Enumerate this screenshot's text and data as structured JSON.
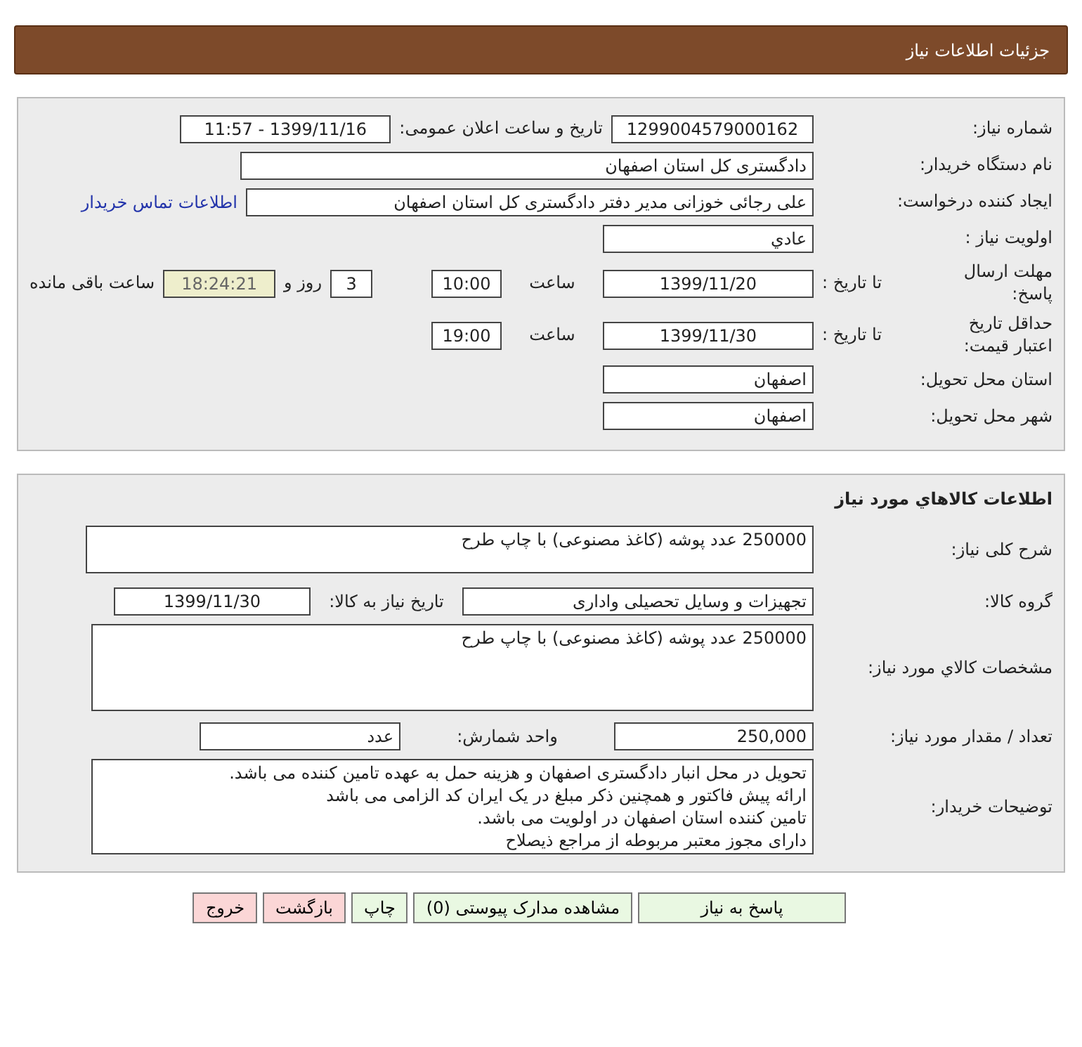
{
  "header": {
    "title": "جزئیات اطلاعات نیاز"
  },
  "general": {
    "need_number": {
      "label": "شماره نیاز:",
      "value": "1299004579000162"
    },
    "announce": {
      "label": "تاریخ و ساعت اعلان عمومی:",
      "value": "1399/11/16 - 11:57"
    },
    "buyer_org": {
      "label": "نام دستگاه خریدار:",
      "value": "دادگستری کل استان اصفهان"
    },
    "creator": {
      "label": "ایجاد کننده درخواست:",
      "value": "علی رجائی خوزانی مدیر دفتر دادگستری کل استان اصفهان",
      "link": "اطلاعات تماس خریدار"
    },
    "priority": {
      "label": "اولویت نیاز :",
      "value": "عادي"
    },
    "response_deadline": {
      "label": "مهلت ارسال پاسخ:",
      "sublabel": "تا تاریخ :",
      "date": "1399/11/20",
      "time_label": "ساعت",
      "time": "10:00",
      "days": "3",
      "days_label": "روز و",
      "remaining": "18:24:21",
      "remaining_label": "ساعت باقی مانده"
    },
    "price_validity": {
      "label": "حداقل تاریخ اعتبار قیمت:",
      "sublabel": "تا تاریخ :",
      "date": "1399/11/30",
      "time_label": "ساعت",
      "time": "19:00"
    },
    "province": {
      "label": "استان محل تحویل:",
      "value": "اصفهان"
    },
    "city": {
      "label": "شهر محل تحویل:",
      "value": "اصفهان"
    }
  },
  "goods": {
    "title": "اطلاعات کالاهاي مورد نیاز",
    "summary": {
      "label": "شرح کلی نیاز:",
      "value": "250000 عدد پوشه (کاغذ مصنوعی) با چاپ طرح"
    },
    "group": {
      "label": "گروه کالا:",
      "value": "تجهیزات و وسایل تحصیلی واداری"
    },
    "need_date": {
      "label": "تاریخ نیاز به کالا:",
      "value": "1399/11/30"
    },
    "specs": {
      "label": "مشخصات کالاي مورد نیاز:",
      "value": "250000 عدد پوشه (کاغذ مصنوعی) با چاپ طرح"
    },
    "quantity": {
      "label": "تعداد / مقدار مورد نیاز:",
      "value": "250,000"
    },
    "unit": {
      "label": "واحد شمارش:",
      "value": "عدد"
    },
    "notes": {
      "label": "توضیحات خریدار:",
      "lines": [
        "تحویل در محل انبار دادگستری اصفهان و هزینه حمل به عهده تامین کننده می باشد.",
        "ارائه پیش فاکتور و همچنین ذکر مبلغ در یک ایران کد الزامی می باشد",
        "تامین کننده استان اصفهان در اولویت می باشد.",
        "دارای مجوز معتبر مربوطه از مراجع ذیصلاح"
      ]
    }
  },
  "buttons": [
    {
      "label": "پاسخ به نیاز",
      "kind": "primary"
    },
    {
      "label": "مشاهده مدارک پیوستی (0)",
      "kind": "primary"
    },
    {
      "label": "چاپ",
      "kind": "primary"
    },
    {
      "label": "بازگشت",
      "kind": "danger"
    },
    {
      "label": "خروج",
      "kind": "danger"
    }
  ]
}
